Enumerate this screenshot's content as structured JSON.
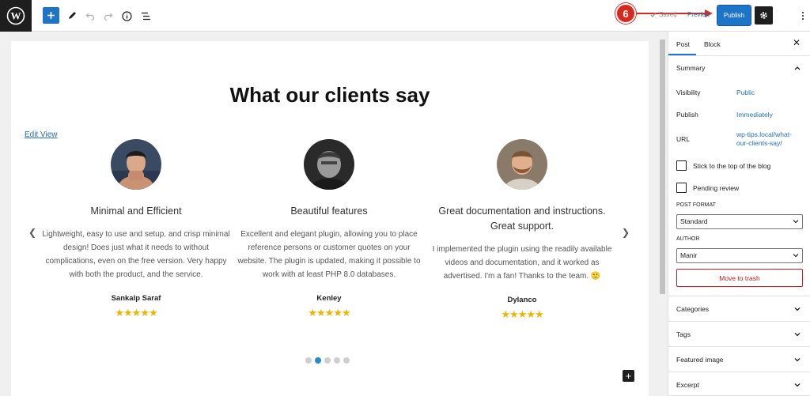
{
  "toolbar": {
    "saved_label": "Saved",
    "preview_label": "Preview",
    "publish_label": "Publish",
    "step_number": "6"
  },
  "content": {
    "title": "What our clients say",
    "edit_view_label": "Edit View",
    "testimonials": [
      {
        "title": "Minimal and Efficient",
        "text": "Lightweight, easy to use and setup, and crisp minimal design! Does just what it needs to without complications, even on the free version. Very happy with both the product, and the service.",
        "author": "Sankalp Saraf",
        "stars": "★★★★★"
      },
      {
        "title": "Beautiful features",
        "text": "Excellent and elegant plugin, allowing you to place reference persons or customer quotes on your website. The plugin is updated, making it possible to work with at least PHP 8.0 databases.",
        "author": "Kenley",
        "stars": "★★★★★"
      },
      {
        "title": "Great documentation and instructions. Great support.",
        "text": "I implemented the plugin using the readily available videos and documentation, and it worked as advertised. I'm a fan! Thanks to the team. 🙂",
        "author": "Dylanco",
        "stars": "★★★★★"
      }
    ],
    "slider_active_index": 1,
    "slider_dot_count": 5
  },
  "sidebar": {
    "tab_post": "Post",
    "tab_block": "Block",
    "summary_title": "Summary",
    "visibility_label": "Visibility",
    "visibility_value": "Public",
    "publish_label": "Publish",
    "publish_value": "Immediately",
    "url_label": "URL",
    "url_value": "wp-tips.local/what-our-clients-say/",
    "stick_label": "Stick to the top of the blog",
    "pending_label": "Pending review",
    "post_format_label": "POST FORMAT",
    "post_format_value": "Standard",
    "author_label": "AUTHOR",
    "author_value": "Manir",
    "trash_label": "Move to trash",
    "panels": [
      "Categories",
      "Tags",
      "Featured image",
      "Excerpt"
    ]
  },
  "colors": {
    "accent": "#1e74c7",
    "step_badge": "#d9281e",
    "stars": "#f0b400",
    "trash": "#cc1818"
  }
}
